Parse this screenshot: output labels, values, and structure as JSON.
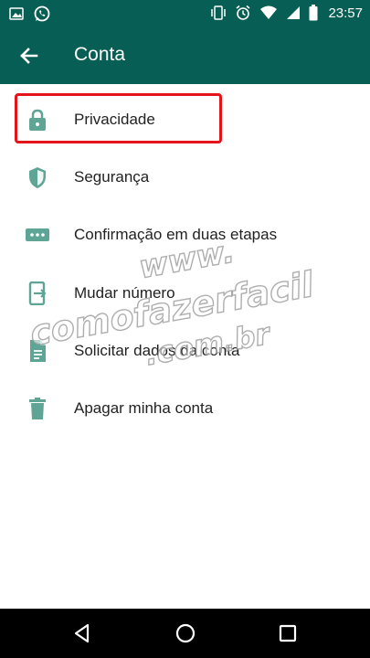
{
  "status_bar": {
    "time": "23:57",
    "left_icons": [
      "gallery-icon",
      "whatsapp-icon"
    ],
    "right_icons": [
      "vibrate-icon",
      "alarm-icon",
      "wifi-icon",
      "signal-icon",
      "battery-icon"
    ]
  },
  "app_bar": {
    "title": "Conta",
    "back_icon": "arrow-back-icon"
  },
  "menu": {
    "items": [
      {
        "label": "Privacidade",
        "icon": "lock-icon"
      },
      {
        "label": "Segurança",
        "icon": "shield-icon"
      },
      {
        "label": "Confirmação em duas etapas",
        "icon": "dots-icon"
      },
      {
        "label": "Mudar número",
        "icon": "phone-change-icon"
      },
      {
        "label": "Solicitar dados da conta",
        "icon": "document-icon"
      },
      {
        "label": "Apagar minha conta",
        "icon": "trash-icon"
      }
    ]
  },
  "watermark": {
    "line1": "www.",
    "line2": "comofazerfacil",
    "line3": ".com.br"
  },
  "nav_bar": {
    "buttons": [
      "back-triangle-icon",
      "home-circle-icon",
      "recents-square-icon"
    ]
  },
  "colors": {
    "primary": "#075e54",
    "icon": "#5fa595",
    "highlight": "#e5141a"
  }
}
